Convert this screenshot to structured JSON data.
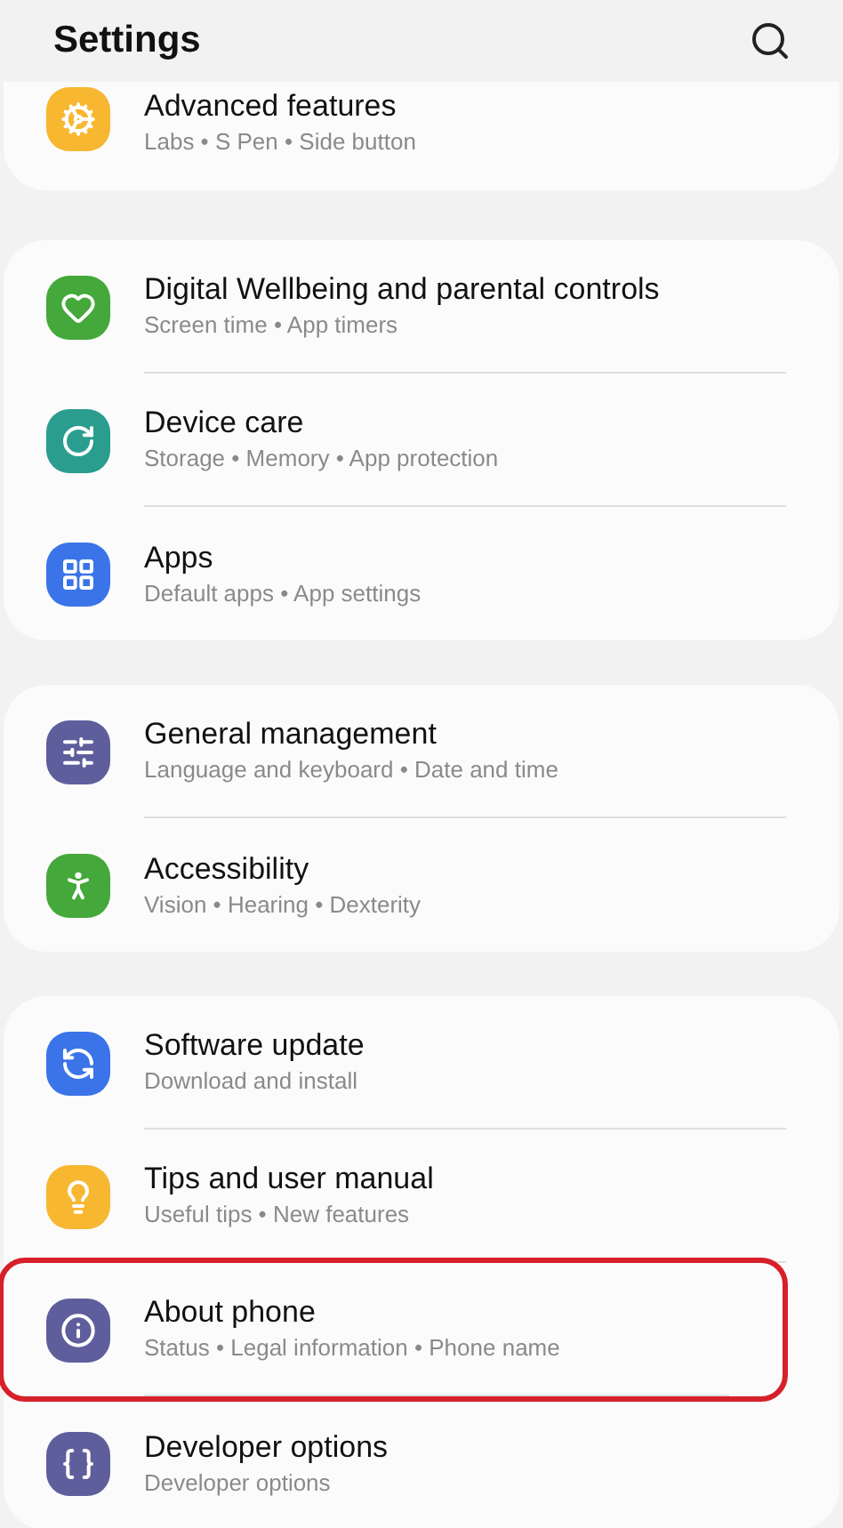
{
  "header": {
    "title": "Settings"
  },
  "sections": [
    {
      "items": [
        {
          "title": "Advanced features",
          "subtitle": "Labs • S Pen • Side button",
          "color": "#f7b731",
          "highlighted": false
        }
      ]
    },
    {
      "items": [
        {
          "title": "Digital Wellbeing and parental controls",
          "subtitle": "Screen time • App timers",
          "color": "#44a83a",
          "highlighted": false
        },
        {
          "title": "Device care",
          "subtitle": "Storage • Memory • App protection",
          "color": "#2a9d8f",
          "highlighted": false
        },
        {
          "title": "Apps",
          "subtitle": "Default apps • App settings",
          "color": "#3a74e8",
          "highlighted": false
        }
      ]
    },
    {
      "items": [
        {
          "title": "General management",
          "subtitle": "Language and keyboard • Date and time",
          "color": "#5f5e9c",
          "highlighted": false
        },
        {
          "title": "Accessibility",
          "subtitle": "Vision • Hearing • Dexterity",
          "color": "#44a83a",
          "highlighted": false
        }
      ]
    },
    {
      "items": [
        {
          "title": "Software update",
          "subtitle": "Download and install",
          "color": "#3a74e8",
          "highlighted": false
        },
        {
          "title": "Tips and user manual",
          "subtitle": "Useful tips • New features",
          "color": "#f7b731",
          "highlighted": false
        },
        {
          "title": "About phone",
          "subtitle": "Status • Legal information • Phone name",
          "color": "#5f5e9c",
          "highlighted": true
        },
        {
          "title": "Developer options",
          "subtitle": "Developer options",
          "color": "#5f5e9c",
          "highlighted": false
        }
      ]
    }
  ]
}
